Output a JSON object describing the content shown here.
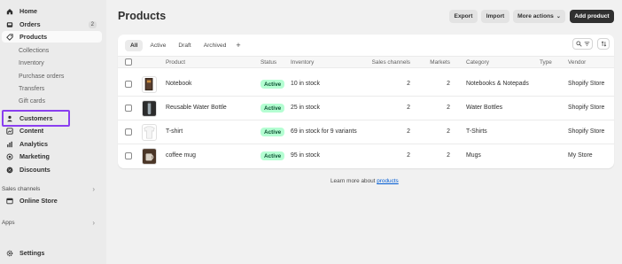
{
  "sidebar": {
    "items": [
      {
        "label": "Home",
        "icon": "home-icon"
      },
      {
        "label": "Orders",
        "icon": "orders-icon",
        "count": "2"
      },
      {
        "label": "Products",
        "icon": "tag-icon"
      },
      {
        "label": "Customers",
        "icon": "person-icon"
      },
      {
        "label": "Content",
        "icon": "content-icon"
      },
      {
        "label": "Analytics",
        "icon": "bar-chart-icon"
      },
      {
        "label": "Marketing",
        "icon": "target-icon"
      },
      {
        "label": "Discounts",
        "icon": "discount-icon"
      }
    ],
    "product_subitems": [
      "Collections",
      "Inventory",
      "Purchase orders",
      "Transfers",
      "Gift cards"
    ],
    "sales_channels_label": "Sales channels",
    "online_store_label": "Online Store",
    "apps_label": "Apps",
    "settings_label": "Settings"
  },
  "header": {
    "title": "Products",
    "export_label": "Export",
    "import_label": "Import",
    "more_actions_label": "More actions",
    "add_product_label": "Add product"
  },
  "tabs": [
    "All",
    "Active",
    "Draft",
    "Archived"
  ],
  "table": {
    "columns": [
      "Product",
      "Status",
      "Inventory",
      "Sales channels",
      "Markets",
      "Category",
      "Type",
      "Vendor"
    ],
    "rows": [
      {
        "product": "Notebook",
        "status": "Active",
        "inventory": "10 in stock",
        "sales_channels": "2",
        "markets": "2",
        "category": "Notebooks & Notepads",
        "type": "",
        "vendor": "Shopify Store"
      },
      {
        "product": "Reusable Water Bottle",
        "status": "Active",
        "inventory": "25 in stock",
        "sales_channels": "2",
        "markets": "2",
        "category": "Water Bottles",
        "type": "",
        "vendor": "Shopify Store"
      },
      {
        "product": "T-shirt",
        "status": "Active",
        "inventory": "69 in stock for 9 variants",
        "sales_channels": "2",
        "markets": "2",
        "category": "T-Shirts",
        "type": "",
        "vendor": "Shopify Store"
      },
      {
        "product": "coffee mug",
        "status": "Active",
        "inventory": "95 in stock",
        "sales_channels": "2",
        "markets": "2",
        "category": "Mugs",
        "type": "",
        "vendor": "My Store"
      }
    ]
  },
  "footer": {
    "learn_text": "Learn more about",
    "learn_link": "products"
  },
  "colors": {
    "active_badge_bg": "#b4fed2",
    "active_badge_text": "#0c5132",
    "highlight": "#8a3ff0",
    "primary_button": "#303030",
    "link": "#005bd3"
  }
}
